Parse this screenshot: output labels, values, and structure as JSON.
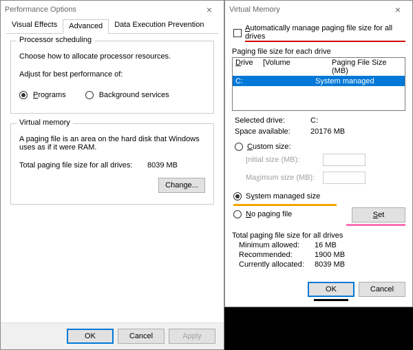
{
  "left": {
    "title": "Performance Options",
    "tabs": {
      "visual": "Visual Effects",
      "advanced": "Advanced",
      "dep": "Data Execution Prevention"
    },
    "proc": {
      "legend": "Processor scheduling",
      "desc": "Choose how to allocate processor resources.",
      "adjust": "Adjust for best performance of:",
      "programs": "Programs",
      "bgs": "Background services"
    },
    "vm": {
      "legend": "Virtual memory",
      "desc": "A paging file is an area on the hard disk that Windows uses as if it were RAM.",
      "totalLabel": "Total paging file size for all drives:",
      "totalValue": "8039 MB",
      "change": "Change..."
    },
    "buttons": {
      "ok": "OK",
      "cancel": "Cancel",
      "apply": "Apply"
    }
  },
  "right": {
    "title": "Virtual Memory",
    "autoLabel": "Automatically manage paging file size for all drives",
    "eachDrive": "Paging file size for each drive",
    "head": {
      "drive": "Drive",
      "volume": "[Volume",
      "size": "Paging File Size (MB)"
    },
    "row": {
      "drive": "C:",
      "size": "System managed"
    },
    "selectedDriveLabel": "Selected drive:",
    "selectedDrive": "C:",
    "spaceLabel": "Space available:",
    "space": "20176 MB",
    "custom": "Custom size:",
    "initial": "Initial size (MB):",
    "max": "Maximum size (MB):",
    "sysManaged": "System managed size",
    "noPaging": "No paging file",
    "set": "Set",
    "totalTitle": "Total paging file size for all drives",
    "minLabel": "Minimum allowed:",
    "min": "16 MB",
    "recLabel": "Recommended:",
    "rec": "1900 MB",
    "curLabel": "Currently allocated:",
    "cur": "8039 MB",
    "ok": "OK",
    "cancel": "Cancel"
  }
}
